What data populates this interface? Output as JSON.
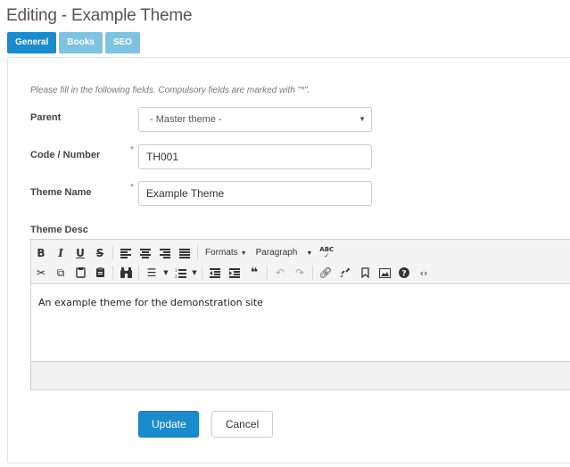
{
  "header": {
    "title": "Editing - Example Theme"
  },
  "tabs": [
    {
      "label": "General",
      "active": true
    },
    {
      "label": "Books",
      "active": false
    },
    {
      "label": "SEO",
      "active": false
    }
  ],
  "form": {
    "intro": "Please fill in the following fields. Compulsory fields are marked with \"*\".",
    "required_mark": "*",
    "parent": {
      "label": "Parent",
      "value": "- Master theme -"
    },
    "code": {
      "label": "Code / Number",
      "value": "TH001",
      "required": true
    },
    "name": {
      "label": "Theme Name",
      "value": "Example Theme",
      "required": true
    },
    "desc": {
      "label": "Theme Desc",
      "content": "An example theme for the demonstration site"
    }
  },
  "editor": {
    "formats_label": "Formats",
    "paragraph_label": "Paragraph",
    "toolbar_row1": [
      "bold-icon",
      "italic-icon",
      "underline-icon",
      "strikethrough-icon",
      "align-left-icon",
      "align-center-icon",
      "align-right-icon",
      "align-justify-icon",
      "formats-menu",
      "paragraph-menu",
      "spellcheck-icon"
    ],
    "toolbar_row2": [
      "cut-icon",
      "copy-icon",
      "paste-icon",
      "paste-text-icon",
      "find-replace-icon",
      "bullet-list-icon",
      "numbered-list-icon",
      "outdent-icon",
      "indent-icon",
      "blockquote-icon",
      "undo-icon",
      "redo-icon",
      "link-icon",
      "unlink-icon",
      "bookmark-icon",
      "image-icon",
      "help-icon",
      "source-code-icon"
    ]
  },
  "buttons": {
    "update": "Update",
    "cancel": "Cancel"
  },
  "colors": {
    "primary": "#1a8bcd",
    "tab_inactive": "#7ec3e0",
    "required": "#d9534f"
  }
}
